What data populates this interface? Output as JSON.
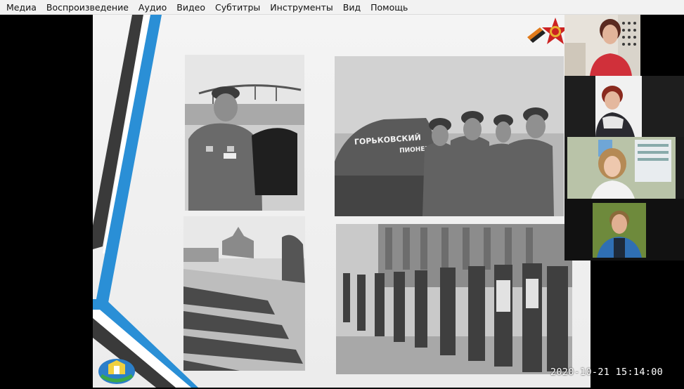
{
  "menu": {
    "items": [
      {
        "label": "Медиа"
      },
      {
        "label": "Воспроизведение"
      },
      {
        "label": "Аудио"
      },
      {
        "label": "Видео"
      },
      {
        "label": "Субтитры"
      },
      {
        "label": "Инструменты"
      },
      {
        "label": "Вид"
      },
      {
        "label": "Помощь"
      }
    ]
  },
  "slide": {
    "tank_inscription": "ГОРЬКОВСКИЙ\nПИОНЕР",
    "accent_color": "#2a8fd6",
    "dark_stripe_color": "#3a3a3a"
  },
  "participants": [
    {
      "name_icon": "participant-1-video"
    },
    {
      "name_icon": "participant-2-video"
    },
    {
      "name_icon": "participant-3-video"
    },
    {
      "name_icon": "participant-4-video"
    }
  ],
  "overlay": {
    "timestamp": "2020-10-21  15:14:00"
  }
}
